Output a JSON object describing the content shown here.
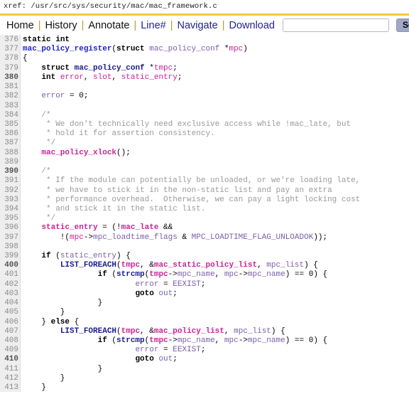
{
  "xref": {
    "label": "xref:",
    "path": "/usr/src/sys/security/mac/mac_framework.c",
    "full": "xref: /usr/src/sys/security/mac/mac_framework.c"
  },
  "menubar": {
    "links": [
      {
        "label": "Home",
        "style": "strong"
      },
      {
        "label": "History",
        "style": "strong"
      },
      {
        "label": "Annotate",
        "style": "strong"
      },
      {
        "label": "Line#",
        "style": "link"
      },
      {
        "label": "Navigate",
        "style": "link"
      },
      {
        "label": "Download",
        "style": "link"
      }
    ],
    "separator": "|",
    "search": {
      "value": "",
      "placeholder": ""
    },
    "search_button": "Search",
    "advanced_checkbox_checked": false
  },
  "colors": {
    "rule": "#f2c744",
    "gutter_bg": "#eeeeee",
    "lineno": "#8a8a8a",
    "symbol": "#cc2299",
    "definition": "#2222cc",
    "function": "#1b1b8f",
    "comment": "#9a9a9a",
    "variable": "#7a5fa8",
    "search_button_bg": "#9fa8c4"
  },
  "code": {
    "first_line": 376,
    "last_line": 413,
    "language": "c",
    "lines": [
      {
        "n": 376,
        "tokens": [
          {
            "t": "static",
            "c": "t-kw"
          },
          {
            "t": " ",
            "c": "t-plain"
          },
          {
            "t": "int",
            "c": "t-kw"
          }
        ]
      },
      {
        "n": 377,
        "tokens": [
          {
            "t": "mac_policy_register",
            "c": "t-def"
          },
          {
            "t": "(",
            "c": "t-plain"
          },
          {
            "t": "struct",
            "c": "t-kw"
          },
          {
            "t": " ",
            "c": "t-plain"
          },
          {
            "t": "mac_policy_conf",
            "c": "t-var"
          },
          {
            "t": " *",
            "c": "t-plain"
          },
          {
            "t": "mpc",
            "c": "t-sym"
          },
          {
            "t": ")",
            "c": "t-plain"
          }
        ]
      },
      {
        "n": 378,
        "tokens": [
          {
            "t": "{",
            "c": "t-plain"
          }
        ]
      },
      {
        "n": 379,
        "tokens": [
          {
            "t": "    ",
            "c": "t-plain"
          },
          {
            "t": "struct",
            "c": "t-kw"
          },
          {
            "t": " ",
            "c": "t-plain"
          },
          {
            "t": "mac_policy_conf",
            "c": "t-fn"
          },
          {
            "t": " *",
            "c": "t-plain"
          },
          {
            "t": "tmpc",
            "c": "t-sym"
          },
          {
            "t": ";",
            "c": "t-plain"
          }
        ]
      },
      {
        "n": 380,
        "tokens": [
          {
            "t": "    ",
            "c": "t-plain"
          },
          {
            "t": "int",
            "c": "t-kw"
          },
          {
            "t": " ",
            "c": "t-plain"
          },
          {
            "t": "error",
            "c": "t-sym"
          },
          {
            "t": ", ",
            "c": "t-plain"
          },
          {
            "t": "slot",
            "c": "t-sym"
          },
          {
            "t": ", ",
            "c": "t-plain"
          },
          {
            "t": "static_entry",
            "c": "t-sym"
          },
          {
            "t": ";",
            "c": "t-plain"
          }
        ]
      },
      {
        "n": 381,
        "tokens": []
      },
      {
        "n": 382,
        "tokens": [
          {
            "t": "    ",
            "c": "t-plain"
          },
          {
            "t": "error",
            "c": "t-var"
          },
          {
            "t": " = ",
            "c": "t-plain"
          },
          {
            "t": "0",
            "c": "t-num"
          },
          {
            "t": ";",
            "c": "t-plain"
          }
        ]
      },
      {
        "n": 383,
        "tokens": []
      },
      {
        "n": 384,
        "tokens": [
          {
            "t": "    /*",
            "c": "t-com"
          }
        ]
      },
      {
        "n": 385,
        "tokens": [
          {
            "t": "     * We don't technically need exclusive access while !mac_late, but",
            "c": "t-com"
          }
        ]
      },
      {
        "n": 386,
        "tokens": [
          {
            "t": "     * hold it for assertion consistency.",
            "c": "t-com"
          }
        ]
      },
      {
        "n": 387,
        "tokens": [
          {
            "t": "     */",
            "c": "t-com"
          }
        ]
      },
      {
        "n": 388,
        "tokens": [
          {
            "t": "    ",
            "c": "t-plain"
          },
          {
            "t": "mac_policy_xlock",
            "c": "t-mac"
          },
          {
            "t": "();",
            "c": "t-plain"
          }
        ]
      },
      {
        "n": 389,
        "tokens": []
      },
      {
        "n": 390,
        "tokens": [
          {
            "t": "    /*",
            "c": "t-com"
          }
        ]
      },
      {
        "n": 391,
        "tokens": [
          {
            "t": "     * If the module can potentially be unloaded, or we're loading late,",
            "c": "t-com"
          }
        ]
      },
      {
        "n": 392,
        "tokens": [
          {
            "t": "     * we have to stick it in the non-static list and pay an extra",
            "c": "t-com"
          }
        ]
      },
      {
        "n": 393,
        "tokens": [
          {
            "t": "     * performance overhead.  Otherwise, we can pay a light locking cost",
            "c": "t-com"
          }
        ]
      },
      {
        "n": 394,
        "tokens": [
          {
            "t": "     * and stick it in the static list.",
            "c": "t-com"
          }
        ]
      },
      {
        "n": 395,
        "tokens": [
          {
            "t": "     */",
            "c": "t-com"
          }
        ]
      },
      {
        "n": 396,
        "tokens": [
          {
            "t": "    ",
            "c": "t-plain"
          },
          {
            "t": "static_entry",
            "c": "t-mac"
          },
          {
            "t": " = (!",
            "c": "t-plain"
          },
          {
            "t": "mac_late",
            "c": "t-mac"
          },
          {
            "t": " &&",
            "c": "t-plain"
          }
        ]
      },
      {
        "n": 397,
        "tokens": [
          {
            "t": "        !(",
            "c": "t-plain"
          },
          {
            "t": "mpc",
            "c": "t-sym"
          },
          {
            "t": "->",
            "c": "t-plain"
          },
          {
            "t": "mpc_loadtime_flags",
            "c": "t-var"
          },
          {
            "t": " & ",
            "c": "t-plain"
          },
          {
            "t": "MPC_LOADTIME_FLAG_UNLOADOK",
            "c": "t-var"
          },
          {
            "t": "));",
            "c": "t-plain"
          }
        ]
      },
      {
        "n": 398,
        "tokens": []
      },
      {
        "n": 399,
        "tokens": [
          {
            "t": "    ",
            "c": "t-plain"
          },
          {
            "t": "if",
            "c": "t-kw"
          },
          {
            "t": " (",
            "c": "t-plain"
          },
          {
            "t": "static_entry",
            "c": "t-var"
          },
          {
            "t": ") {",
            "c": "t-plain"
          }
        ]
      },
      {
        "n": 400,
        "tokens": [
          {
            "t": "        ",
            "c": "t-plain"
          },
          {
            "t": "LIST_FOREACH",
            "c": "t-fn"
          },
          {
            "t": "(",
            "c": "t-plain"
          },
          {
            "t": "tmpc",
            "c": "t-mac"
          },
          {
            "t": ", &",
            "c": "t-plain"
          },
          {
            "t": "mac_static_policy_list",
            "c": "t-mac"
          },
          {
            "t": ", ",
            "c": "t-plain"
          },
          {
            "t": "mpc_list",
            "c": "t-var"
          },
          {
            "t": ") {",
            "c": "t-plain"
          }
        ]
      },
      {
        "n": 401,
        "tokens": [
          {
            "t": "                ",
            "c": "t-plain"
          },
          {
            "t": "if",
            "c": "t-kw"
          },
          {
            "t": " (",
            "c": "t-plain"
          },
          {
            "t": "strcmp",
            "c": "t-fn"
          },
          {
            "t": "(",
            "c": "t-plain"
          },
          {
            "t": "tmpc",
            "c": "t-mac"
          },
          {
            "t": "->",
            "c": "t-plain"
          },
          {
            "t": "mpc_name",
            "c": "t-var"
          },
          {
            "t": ", ",
            "c": "t-plain"
          },
          {
            "t": "mpc",
            "c": "t-var"
          },
          {
            "t": "->",
            "c": "t-plain"
          },
          {
            "t": "mpc_name",
            "c": "t-var"
          },
          {
            "t": ") == ",
            "c": "t-plain"
          },
          {
            "t": "0",
            "c": "t-num"
          },
          {
            "t": ") {",
            "c": "t-plain"
          }
        ]
      },
      {
        "n": 402,
        "tokens": [
          {
            "t": "                        ",
            "c": "t-plain"
          },
          {
            "t": "error",
            "c": "t-var"
          },
          {
            "t": " = ",
            "c": "t-plain"
          },
          {
            "t": "EEXIST",
            "c": "t-var"
          },
          {
            "t": ";",
            "c": "t-plain"
          }
        ]
      },
      {
        "n": 403,
        "tokens": [
          {
            "t": "                        ",
            "c": "t-plain"
          },
          {
            "t": "goto",
            "c": "t-kw"
          },
          {
            "t": " ",
            "c": "t-plain"
          },
          {
            "t": "out",
            "c": "t-var"
          },
          {
            "t": ";",
            "c": "t-plain"
          }
        ]
      },
      {
        "n": 404,
        "tokens": [
          {
            "t": "                }",
            "c": "t-plain"
          }
        ]
      },
      {
        "n": 405,
        "tokens": [
          {
            "t": "        }",
            "c": "t-plain"
          }
        ]
      },
      {
        "n": 406,
        "tokens": [
          {
            "t": "    } ",
            "c": "t-plain"
          },
          {
            "t": "else",
            "c": "t-kw"
          },
          {
            "t": " {",
            "c": "t-plain"
          }
        ]
      },
      {
        "n": 407,
        "tokens": [
          {
            "t": "        ",
            "c": "t-plain"
          },
          {
            "t": "LIST_FOREACH",
            "c": "t-fn"
          },
          {
            "t": "(",
            "c": "t-plain"
          },
          {
            "t": "tmpc",
            "c": "t-mac"
          },
          {
            "t": ", &",
            "c": "t-plain"
          },
          {
            "t": "mac_policy_list",
            "c": "t-mac"
          },
          {
            "t": ", ",
            "c": "t-plain"
          },
          {
            "t": "mpc_list",
            "c": "t-var"
          },
          {
            "t": ") {",
            "c": "t-plain"
          }
        ]
      },
      {
        "n": 408,
        "tokens": [
          {
            "t": "                ",
            "c": "t-plain"
          },
          {
            "t": "if",
            "c": "t-kw"
          },
          {
            "t": " (",
            "c": "t-plain"
          },
          {
            "t": "strcmp",
            "c": "t-fn"
          },
          {
            "t": "(",
            "c": "t-plain"
          },
          {
            "t": "tmpc",
            "c": "t-mac"
          },
          {
            "t": "->",
            "c": "t-plain"
          },
          {
            "t": "mpc_name",
            "c": "t-var"
          },
          {
            "t": ", ",
            "c": "t-plain"
          },
          {
            "t": "mpc",
            "c": "t-var"
          },
          {
            "t": "->",
            "c": "t-plain"
          },
          {
            "t": "mpc_name",
            "c": "t-var"
          },
          {
            "t": ") == ",
            "c": "t-plain"
          },
          {
            "t": "0",
            "c": "t-num"
          },
          {
            "t": ") {",
            "c": "t-plain"
          }
        ]
      },
      {
        "n": 409,
        "tokens": [
          {
            "t": "                        ",
            "c": "t-plain"
          },
          {
            "t": "error",
            "c": "t-var"
          },
          {
            "t": " = ",
            "c": "t-plain"
          },
          {
            "t": "EEXIST",
            "c": "t-var"
          },
          {
            "t": ";",
            "c": "t-plain"
          }
        ]
      },
      {
        "n": 410,
        "tokens": [
          {
            "t": "                        ",
            "c": "t-plain"
          },
          {
            "t": "goto",
            "c": "t-kw"
          },
          {
            "t": " ",
            "c": "t-plain"
          },
          {
            "t": "out",
            "c": "t-var"
          },
          {
            "t": ";",
            "c": "t-plain"
          }
        ]
      },
      {
        "n": 411,
        "tokens": [
          {
            "t": "                }",
            "c": "t-plain"
          }
        ]
      },
      {
        "n": 412,
        "tokens": [
          {
            "t": "        }",
            "c": "t-plain"
          }
        ]
      },
      {
        "n": 413,
        "tokens": [
          {
            "t": "    }",
            "c": "t-plain"
          }
        ]
      }
    ]
  }
}
